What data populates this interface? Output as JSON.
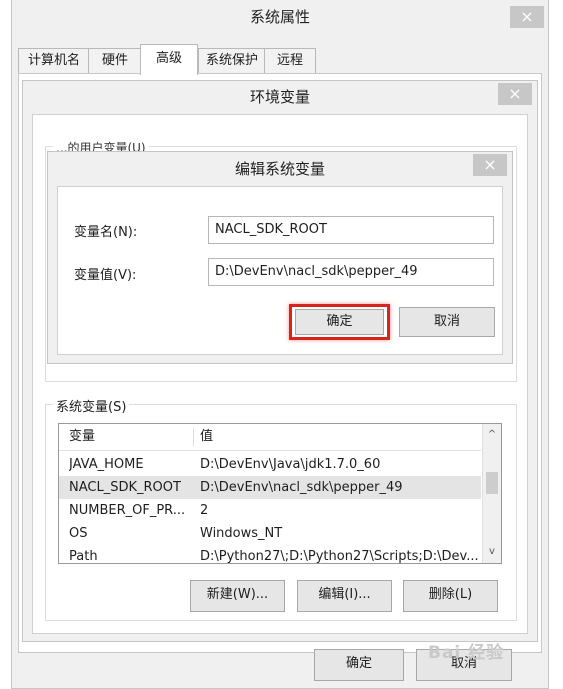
{
  "system_properties": {
    "title": "系统属性",
    "close": "×",
    "tabs": [
      "计算机名",
      "硬件",
      "高级",
      "系统保护",
      "远程"
    ],
    "ok_label": "确定",
    "cancel_label": "取消"
  },
  "env_dialog": {
    "title": "环境变量",
    "close": "×",
    "user_section_label_partial": "...的用户变量(U)",
    "system_section_label": "系统变量(S)",
    "columns": [
      "变量",
      "值"
    ],
    "rows": [
      {
        "name": "JAVA_HOME",
        "value": "D:\\DevEnv\\Java\\jdk1.7.0_60"
      },
      {
        "name": "NACL_SDK_ROOT",
        "value": "D:\\DevEnv\\nacl_sdk\\pepper_49"
      },
      {
        "name": "NUMBER_OF_PR...",
        "value": "2"
      },
      {
        "name": "OS",
        "value": "Windows_NT"
      },
      {
        "name": "Path",
        "value": "D:\\Python27\\;D:\\Python27\\Scripts;D:\\Dev..."
      }
    ],
    "selected_row": "NACL_SDK_ROOT",
    "new_label": "新建(W)...",
    "edit_label": "编辑(I)...",
    "delete_label": "删除(L)"
  },
  "edit_dialog": {
    "title": "编辑系统变量",
    "close": "×",
    "name_label": "变量名(N):",
    "name_value": "NACL_SDK_ROOT",
    "value_label": "变量值(V):",
    "value_value": "D:\\DevEnv\\nacl_sdk\\pepper_49",
    "ok_label": "确定",
    "cancel_label": "取消",
    "highlight_color": "#d9231d"
  },
  "watermark": "Bai 经验",
  "scroll_up_glyph": "^",
  "scroll_down_glyph": "v"
}
